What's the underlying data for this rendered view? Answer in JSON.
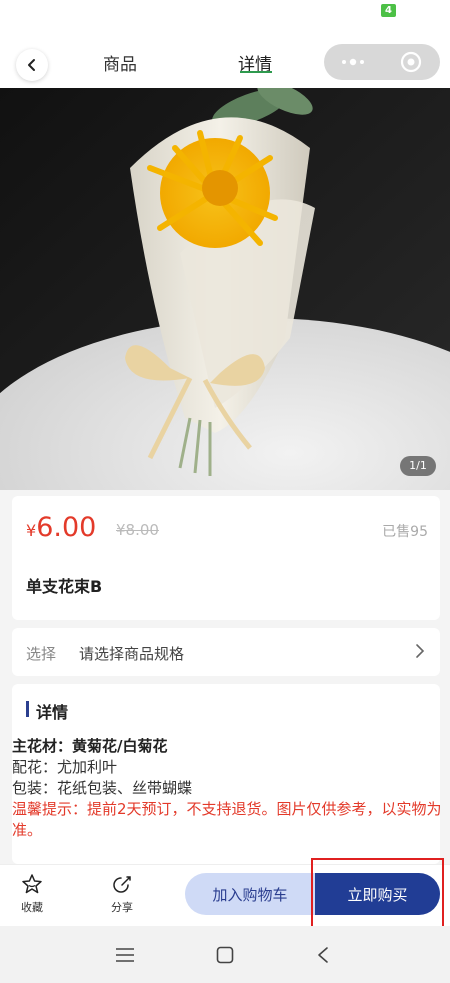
{
  "status_bar": {
    "battery_badge": "4"
  },
  "nav": {
    "tab_goods": "商品",
    "tab_detail": "详情",
    "active_tab": "详情"
  },
  "image": {
    "counter": "1/1"
  },
  "product": {
    "currency": "¥",
    "price": "6.00",
    "original_price": "¥8.00",
    "sold": "已售95",
    "name": "单支花束B"
  },
  "spec": {
    "label": "选择",
    "placeholder": "请选择商品规格"
  },
  "detail": {
    "title": "详情",
    "line1": "主花材：黄菊花/白菊花",
    "line2": "配花：尤加利叶",
    "line3": "包装：花纸包装、丝带蝴蝶",
    "line4": "温馨提示：提前2天预订，不支持退货。图片仅供参考，以实物为准。"
  },
  "actions": {
    "favorite": "收藏",
    "share": "分享",
    "add_to_cart": "加入购物车",
    "buy_now": "立即购买"
  },
  "colors": {
    "price_red": "#e33a2a",
    "brand_blue": "#213d95",
    "cart_light_blue": "#cfdaf6",
    "tab_green": "#2e9a4e"
  },
  "icons": [
    "back-arrow-icon",
    "more-dots-icon",
    "close-circle-icon",
    "chevron-right-icon",
    "star-icon",
    "share-icon",
    "menu-icon",
    "home-square-icon",
    "back-triangle-icon"
  ]
}
